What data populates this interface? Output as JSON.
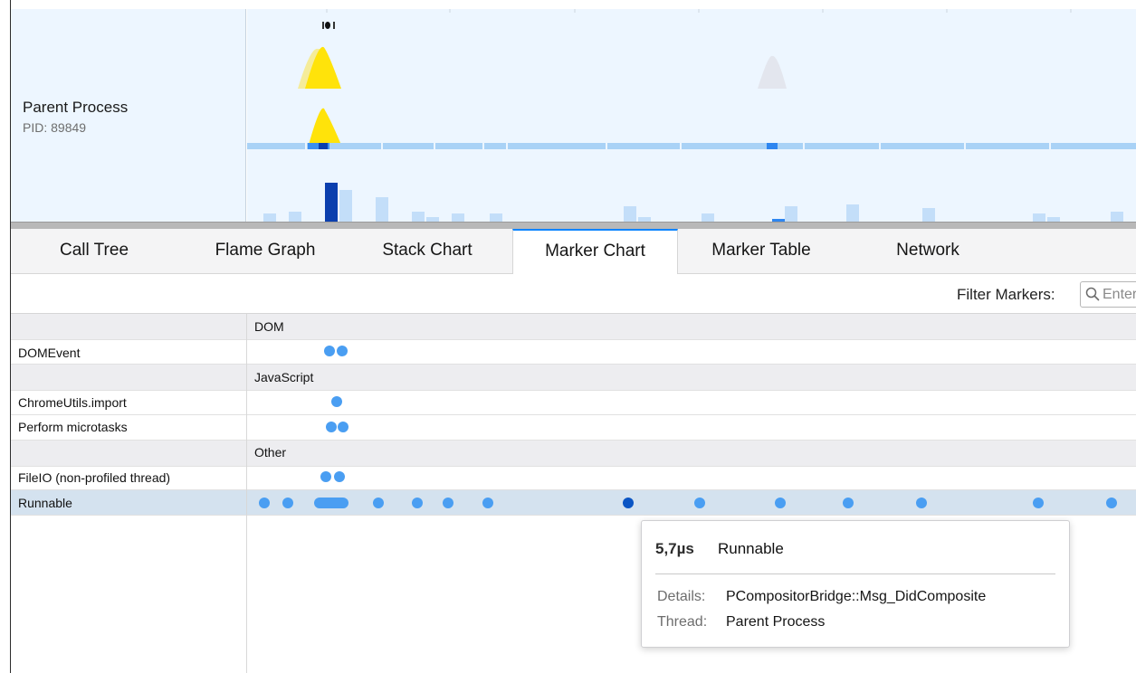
{
  "track": {
    "title": "Parent Process",
    "pid": "PID: 89849"
  },
  "tabs": [
    {
      "label": "Call Tree"
    },
    {
      "label": "Flame Graph"
    },
    {
      "label": "Stack Chart"
    },
    {
      "label": "Marker Chart",
      "selected": true
    },
    {
      "label": "Marker Table"
    },
    {
      "label": "Network"
    }
  ],
  "filter": {
    "label": "Filter Markers:",
    "placeholder": "Enter filter terms"
  },
  "rows": [
    {
      "kind": "category",
      "label": "DOM"
    },
    {
      "kind": "marker",
      "label": "DOMEvent"
    },
    {
      "kind": "category",
      "label": "JavaScript"
    },
    {
      "kind": "marker",
      "label": "ChromeUtils.import"
    },
    {
      "kind": "marker",
      "label": "Perform microtasks"
    },
    {
      "kind": "category",
      "label": "Other"
    },
    {
      "kind": "marker",
      "label": "FileIO (non-profiled thread)"
    },
    {
      "kind": "marker",
      "label": "Runnable",
      "selected": true
    }
  ],
  "tooltip": {
    "duration": "5,7µs",
    "name": "Runnable",
    "details_key": "Details:",
    "details_value": "PCompositorBridge::Msg_DidComposite",
    "thread_key": "Thread:",
    "thread_value": "Parent Process"
  },
  "colors": {
    "accent": "#0a84ff",
    "marker_dot": "#4a9ef2",
    "marker_dot_selected": "#0b55c4",
    "cpu_yellow": "#ffe30a",
    "track_bg": "#edf6ff"
  }
}
